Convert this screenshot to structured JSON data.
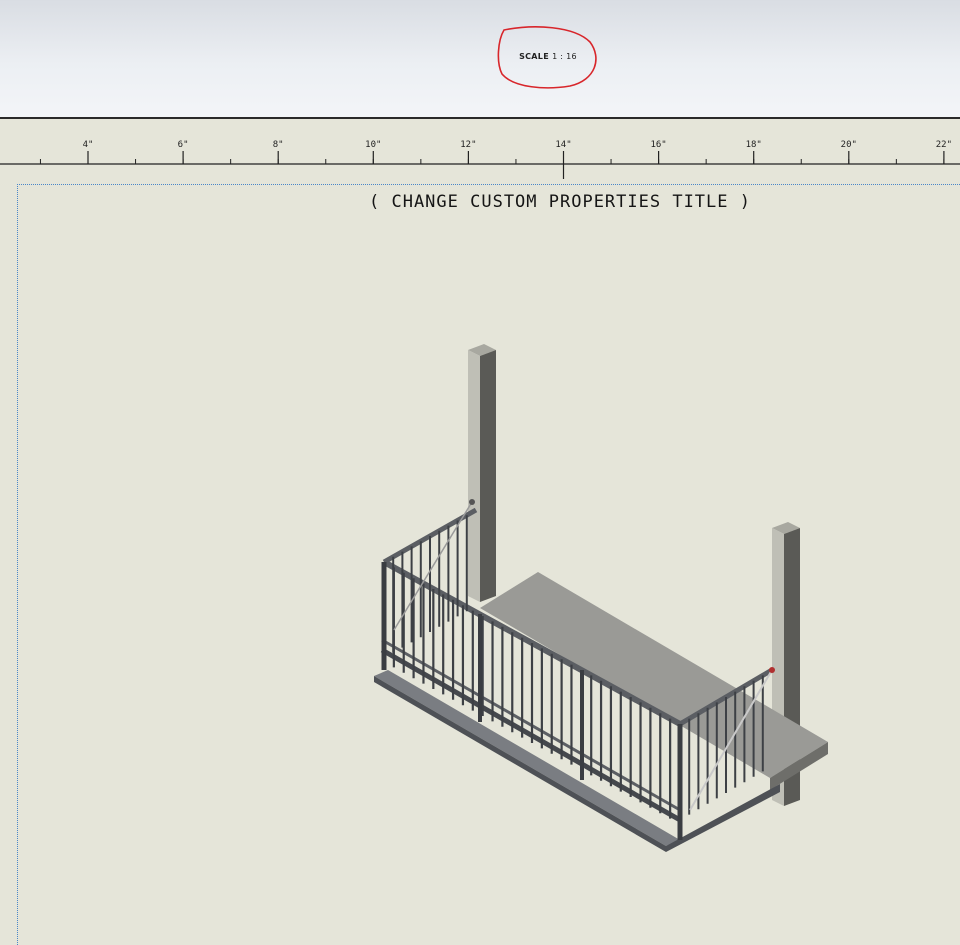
{
  "toolbar": {
    "scale_prefix": "SCALE",
    "scale_value": "1 : 16"
  },
  "ruler": {
    "tick_labels": [
      "4\"",
      "6\"",
      "8\"",
      "10\"",
      "12\"",
      "14\"",
      "16\"",
      "18\"",
      "20\"",
      "22\""
    ]
  },
  "sheet": {
    "title": "( CHANGE CUSTOM PROPERTIES TITLE )"
  },
  "colors": {
    "sheet_background": "#e5e5d9",
    "markup_circle": "#d8262b",
    "sheet_border": "#4a86c8"
  },
  "icons": {
    "markup": "red-circle-markup"
  }
}
